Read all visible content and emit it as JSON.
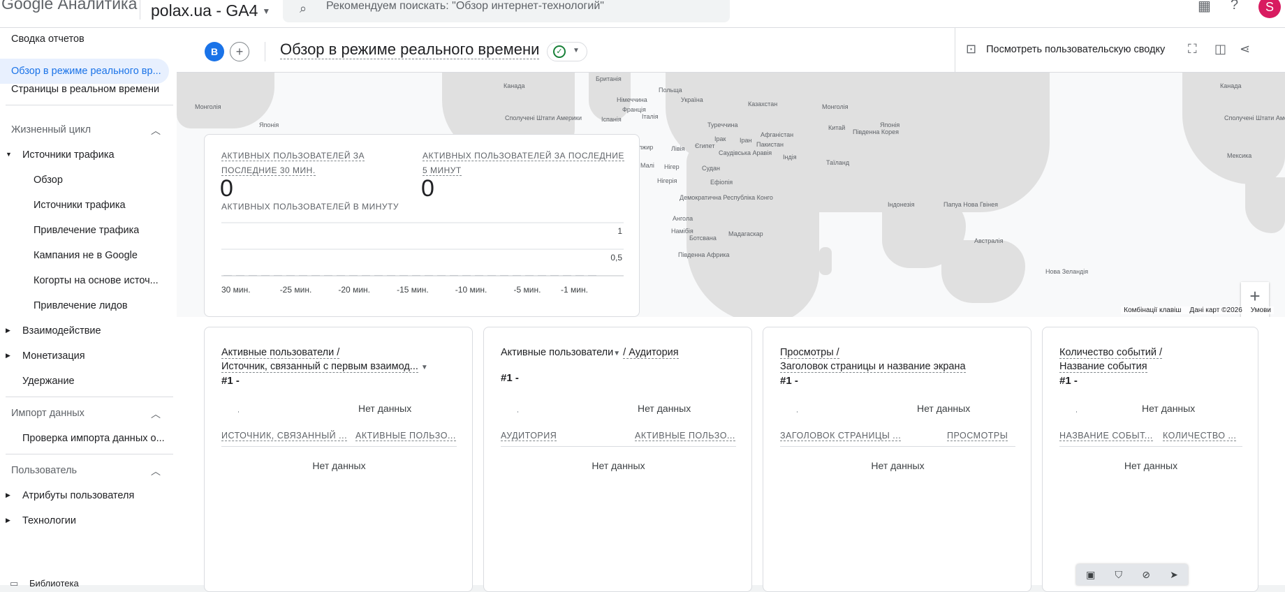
{
  "topbar": {
    "app_title": "Google Аналитика",
    "property": "polax.ua - GA4",
    "search_placeholder": "Рекомендуем поискать: \"Обзор интернет-технологий\"",
    "avatar_letter": "S"
  },
  "sidebar": {
    "items_top": [
      {
        "label": "Сводка отчетов"
      },
      {
        "label": "Обзор в режиме реального вр..."
      },
      {
        "label": "Страницы в реальном времени"
      }
    ],
    "section_lifecycle": "Жизненный цикл",
    "traffic_group": "Источники трафика",
    "traffic_items": [
      {
        "label": "Обзор"
      },
      {
        "label": "Источники трафика"
      },
      {
        "label": "Привлечение трафика"
      },
      {
        "label": "Кампания не в Google"
      },
      {
        "label": "Когорты на основе источ..."
      },
      {
        "label": "Привлечение лидов"
      }
    ],
    "engagement": "Взаимодействие",
    "monetization": "Монетизация",
    "retention": "Удержание",
    "section_import": "Импорт данных",
    "import_check": "Проверка импорта данных о...",
    "section_user": "Пользователь",
    "user_attrs": "Атрибуты пользователя",
    "tech": "Технологии",
    "library": "Библиотека"
  },
  "header": {
    "compare_letter": "B",
    "title": "Обзор в режиме реального времени",
    "custom_summary": "Посмотреть пользовательскую сводку"
  },
  "map": {
    "labels": [
      "Канада",
      "Монголія",
      "Японія",
      "Сполучені Штати Америки",
      "Мексика",
      "Британія",
      "Польща",
      "Німеччина",
      "Україна",
      "Франція",
      "Італія",
      "Іспанія",
      "Казахстан",
      "Монголія",
      "Туреччина",
      "Ірак",
      "Іран",
      "Афганістан",
      "Китай",
      "Японія",
      "Південна Корея",
      "Алжир",
      "Лівія",
      "Єгипет",
      "Пакистан",
      "Саудівська Аравія",
      "Індія",
      "Таїланд",
      "Малі",
      "Нігер",
      "Судан",
      "Нігерія",
      "Ефіопія",
      "Демократична Республіка Конго",
      "Індонезія",
      "Папуа Нова Гвінея",
      "Ангола",
      "Намібія",
      "Ботсвана",
      "Мадагаскар",
      "Австралія",
      "Південна Африка",
      "Нова Зеландія",
      "Канада",
      "Сполучені Штати Америки",
      "Мексика"
    ],
    "footer_shortcuts": "Комбінації клавіш",
    "footer_data": "Дані карт ©2026",
    "footer_terms": "Умови"
  },
  "realtime": {
    "metric1_label": "АКТИВНЫХ ПОЛЬЗОВАТЕЛЕЙ ЗА ПОСЛЕДНИЕ 30 МИН.",
    "metric1_value": "0",
    "metric2_label": "АКТИВНЫХ ПОЛЬЗОВАТЕЛЕЙ ЗА ПОСЛЕДНИЕ 5 МИНУТ",
    "metric2_value": "0",
    "per_minute_label": "АКТИВНЫХ ПОЛЬЗОВАТЕЛЕЙ В МИНУТУ"
  },
  "chart_data": {
    "type": "bar",
    "title": "АКТИВНЫХ ПОЛЬЗОВАТЕЛЕЙ В МИНУТУ",
    "x_tick_labels": [
      "30 мин.",
      "-25 мин.",
      "-20 мин.",
      "-15 мин.",
      "-10 мин.",
      "-5 мин.",
      "-1 мин."
    ],
    "y_tick_labels": [
      "1",
      "0,5"
    ],
    "ylim": [
      0,
      1
    ],
    "bar_count": 30,
    "values": [
      0,
      0,
      0,
      0,
      0,
      0,
      0,
      0,
      0,
      0,
      0,
      0,
      0,
      0,
      0,
      0,
      0,
      0,
      0,
      0,
      0,
      0,
      0,
      0,
      0,
      0,
      0,
      0,
      0,
      0
    ]
  },
  "cards": [
    {
      "title": "Активные пользователи /",
      "subtitle": "Источник, связанный с первым взаимод...",
      "rank": "#1  -",
      "nodata": "Нет данных",
      "col1": "ИСТОЧНИК, СВЯЗАННЫЙ ...",
      "col2": "АКТИВНЫЕ ПОЛЬЗО...",
      "nodata2": "Нет данных"
    },
    {
      "title": "Активные пользователи",
      "title2": "/ Аудитория",
      "subtitle": "",
      "rank": "#1  -",
      "nodata": "Нет данных",
      "col1": "АУДИТОРИЯ",
      "col2": "АКТИВНЫЕ ПОЛЬЗО...",
      "nodata2": "Нет данных"
    },
    {
      "title": "Просмотры /",
      "subtitle": "Заголовок страницы и название экрана",
      "rank": "#1  -",
      "nodata": "Нет данных",
      "col1": "ЗАГОЛОВОК СТРАНИЦЫ ...",
      "col2": "ПРОСМОТРЫ",
      "nodata2": "Нет данных"
    },
    {
      "title": "Количество событий /",
      "subtitle": "Название события",
      "rank": "#1  -",
      "nodata": "Нет данных",
      "col1": "НАЗВАНИЕ СОБЫТ...",
      "col2": "КОЛИЧЕСТВО ...",
      "nodata2": "Нет данных"
    }
  ]
}
